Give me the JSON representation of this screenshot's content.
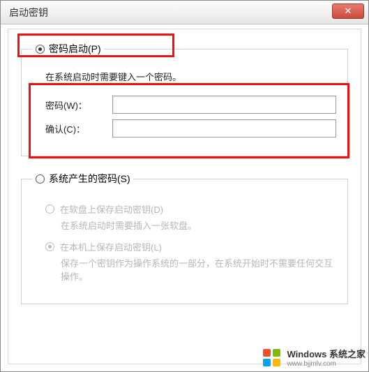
{
  "window": {
    "title": "启动密钥",
    "close_glyph": "✕"
  },
  "group_password": {
    "legend": "密码启动(P)",
    "selected": true,
    "desc": "在系统启动时需要键入一个密码。",
    "password_label": "密码(W)：",
    "confirm_label": "确认(C)：",
    "password_value": "",
    "confirm_value": ""
  },
  "group_system": {
    "legend": "系统产生的密码(S)",
    "selected": false,
    "opt_floppy": {
      "label": "在软盘上保存启动密钥(D)",
      "desc": "在系统启动时需要插入一张软盘。",
      "selected": false
    },
    "opt_local": {
      "label": "在本机上保存启动密钥(L)",
      "desc": "保存一个密钥作为操作系统的一部分，在系统开始时不需要任何交互操作。",
      "selected": true
    }
  },
  "watermark": {
    "line1": "Windows 系统之家",
    "line2": "www.bjjmlv.com",
    "colors": {
      "tl": "#f25022",
      "tr": "#7fba00",
      "bl": "#00a4ef",
      "br": "#ffb900"
    }
  }
}
